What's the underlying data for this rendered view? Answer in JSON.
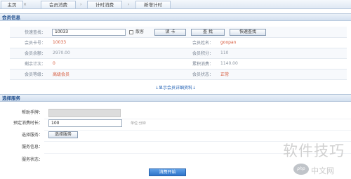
{
  "tabs": {
    "home": "主页",
    "member_consume": "会员消费",
    "timed_consume": "计时消费",
    "new_timing": "新增计时",
    "close_glyph": "×",
    "arrow_glyph": "›"
  },
  "member_section": {
    "title": "会员信息",
    "quick_search_label": "快速查找：",
    "quick_search_value": "10033",
    "checkbox_label": "散客",
    "read_card_button": "读 卡",
    "search_button": "查 找",
    "quick_find_button": "快速查找",
    "rows": [
      {
        "left_label": "会员卡号：",
        "left_value": "10033",
        "right_label": "会员姓名：",
        "right_value": "goopan"
      },
      {
        "left_label": "会员余额：",
        "left_value": "2970.00",
        "right_label": "会员积分：",
        "right_value": "110"
      },
      {
        "left_label": "剩余计次：",
        "left_value": "0",
        "right_label": "累积消费：",
        "right_value": "1140.00"
      },
      {
        "left_label": "会员等级：",
        "left_value": "高级会员",
        "right_label": "会员状态：",
        "right_value": "正常"
      }
    ],
    "show_detail_link": "↓显示会员详细资料↓"
  },
  "service_section": {
    "title": "选择服务",
    "stopwatch_label": "帮助手牌：",
    "preset_label": "预定消费时长：",
    "preset_value": "100",
    "preset_unit": "单位:分钟",
    "choose_label": "选择服务：",
    "choose_button": "选择服务",
    "service_info_label": "服务信息：",
    "service_status_label": "服务状态：",
    "start_button": "消费开始"
  },
  "watermark": {
    "text": "软件技巧",
    "logo_text": "php",
    "site": "中文网"
  }
}
